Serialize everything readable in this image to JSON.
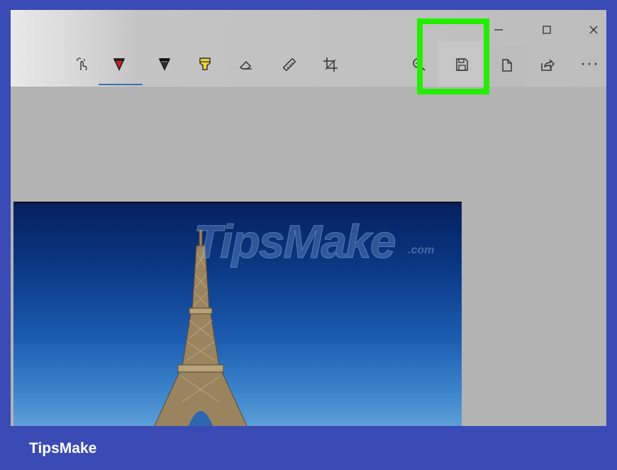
{
  "toolbar": {
    "tools": [
      "touch-writing",
      "ballpoint-pen",
      "pencil",
      "highlighter",
      "eraser",
      "ruler",
      "crop",
      "zoom",
      "save",
      "copy",
      "share",
      "more"
    ],
    "active_tool": "ballpoint-pen",
    "more_label": "···"
  },
  "window_controls": [
    "minimize",
    "maximize",
    "close"
  ],
  "watermark": {
    "text": "TipsMake",
    "suffix": ".com"
  },
  "footer": {
    "brand": "TipsMake"
  },
  "colors": {
    "frame": "#3a4bb5",
    "highlight": "#22ee00",
    "active_underline": "#3b6fb6",
    "pen_red": "#d0201c",
    "highlighter_yellow": "#f0d23a"
  }
}
